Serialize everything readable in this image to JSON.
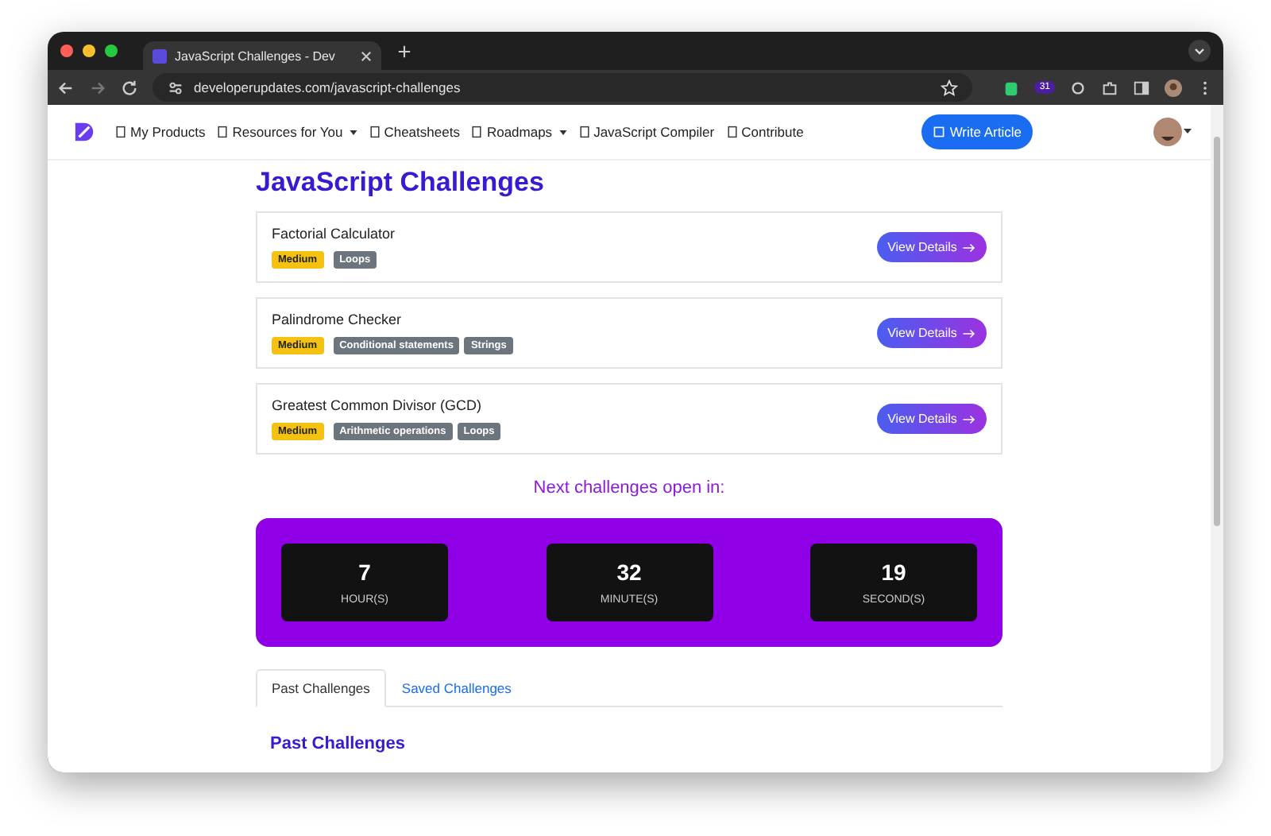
{
  "browser": {
    "tab_title": "JavaScript Challenges - Dev",
    "url": "developerupdates.com/javascript-challenges",
    "extension_badge": "31"
  },
  "nav": {
    "items": [
      {
        "label": "My Products",
        "has_menu": false
      },
      {
        "label": "Resources for You",
        "has_menu": true
      },
      {
        "label": "Cheatsheets",
        "has_menu": false
      },
      {
        "label": "Roadmaps",
        "has_menu": true
      },
      {
        "label": "JavaScript Compiler",
        "has_menu": false
      },
      {
        "label": "Contribute",
        "has_menu": false
      }
    ],
    "write_button": "Write Article"
  },
  "title": "JavaScript Challenges",
  "challenges": [
    {
      "name": "Factorial Calculator",
      "difficulty": "Medium",
      "tags": [
        "Loops"
      ],
      "button": "View Details"
    },
    {
      "name": "Palindrome Checker",
      "difficulty": "Medium",
      "tags": [
        "Conditional statements",
        "Strings"
      ],
      "button": "View Details"
    },
    {
      "name": "Greatest Common Divisor (GCD)",
      "difficulty": "Medium",
      "tags": [
        "Arithmetic operations",
        "Loops"
      ],
      "button": "View Details"
    }
  ],
  "countdown": {
    "heading": "Next challenges open in:",
    "units": [
      {
        "value": "7",
        "label": "HOUR(S)"
      },
      {
        "value": "32",
        "label": "MINUTE(S)"
      },
      {
        "value": "19",
        "label": "SECOND(S)"
      }
    ]
  },
  "tabs": [
    {
      "label": "Past Challenges",
      "selected": true
    },
    {
      "label": "Saved Challenges",
      "selected": false
    }
  ],
  "section_title": "Past Challenges"
}
